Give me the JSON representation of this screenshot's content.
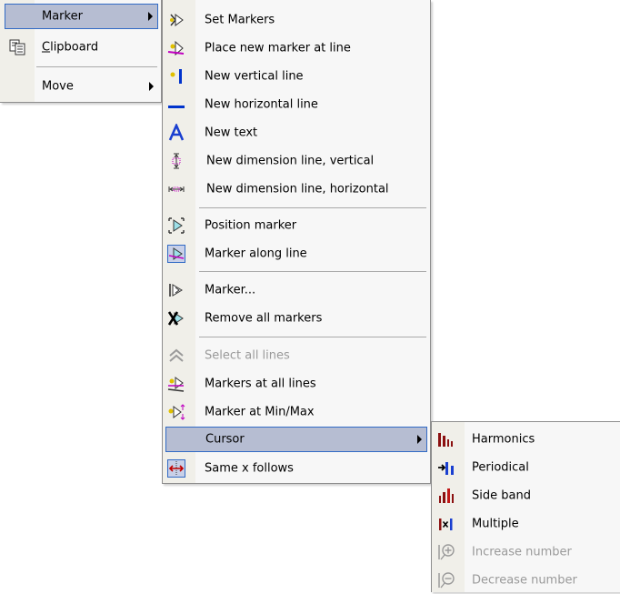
{
  "menu1": {
    "items": [
      {
        "label": "Marker",
        "highlighted": true,
        "submenu": true
      },
      {
        "label_pre": "",
        "label_u": "C",
        "label_post": "lipboard",
        "icon": "clipboard-icon"
      },
      {
        "label": "Move",
        "submenu": true
      }
    ]
  },
  "menu2": {
    "items": [
      {
        "label": "Set Markers",
        "icon": "set-markers-icon"
      },
      {
        "label": "Place new marker at line",
        "icon": "place-marker-icon"
      },
      {
        "label": "New vertical line",
        "icon": "vertical-line-icon"
      },
      {
        "label": "New horizontal line",
        "icon": "horizontal-line-icon"
      },
      {
        "label": "New text",
        "icon": "text-icon"
      },
      {
        "label": "New dimension line, vertical",
        "icon": "dimension-vertical-icon"
      },
      {
        "label": "New dimension line, horizontal",
        "icon": "dimension-horizontal-icon"
      },
      {
        "label": "Position marker",
        "icon": "position-marker-icon"
      },
      {
        "label": "Marker along line",
        "icon": "marker-along-line-icon"
      },
      {
        "label": "Marker...",
        "icon": "marker-dialog-icon"
      },
      {
        "label": "Remove all markers",
        "icon": "remove-markers-icon"
      },
      {
        "label": "Select all lines",
        "icon": "select-lines-icon",
        "disabled": true
      },
      {
        "label": "Markers at all lines",
        "icon": "markers-all-lines-icon"
      },
      {
        "label": "Marker at Min/Max",
        "icon": "marker-minmax-icon"
      },
      {
        "label": "Cursor",
        "highlighted": true,
        "submenu": true
      },
      {
        "label": "Same x follows",
        "icon": "same-x-icon"
      }
    ]
  },
  "menu3": {
    "items": [
      {
        "label": "Harmonics",
        "icon": "harmonics-icon"
      },
      {
        "label": "Periodical",
        "icon": "periodical-icon"
      },
      {
        "label": "Side band",
        "icon": "side-band-icon"
      },
      {
        "label": "Multiple",
        "icon": "multiple-icon"
      },
      {
        "label": "Increase number",
        "icon": "increase-icon",
        "disabled": true
      },
      {
        "label": "Decrease number",
        "icon": "decrease-icon",
        "disabled": true
      }
    ]
  },
  "colors": {
    "highlight": "#b6bdd2",
    "highlight_border": "#316ac5",
    "menu_bg": "#f7f7f7",
    "gutter": "#f0efe9",
    "disabled_text": "#9a9a9a"
  }
}
